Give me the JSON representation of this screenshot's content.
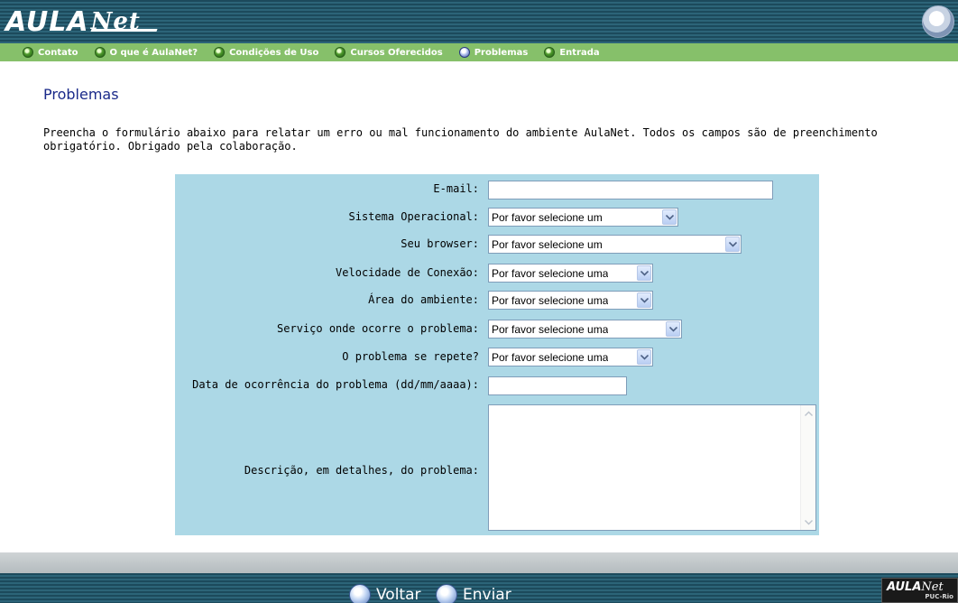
{
  "header": {
    "logo_main": "AULA",
    "logo_net": "Net",
    "nav": [
      {
        "label": "Contato"
      },
      {
        "label": "O que é AulaNet?"
      },
      {
        "label": "Condições de Uso"
      },
      {
        "label": "Cursos Oferecidos"
      },
      {
        "label": "Problemas"
      },
      {
        "label": "Entrada"
      }
    ],
    "active_nav": "Problemas"
  },
  "page": {
    "title": "Problemas",
    "intro": "Preencha o formulário abaixo para relatar um erro ou mal funcionamento do ambiente AulaNet. Todos os campos são de preenchimento obrigatório. Obrigado pela colaboração."
  },
  "form": {
    "email": {
      "label": "E-mail:",
      "value": ""
    },
    "os": {
      "label": "Sistema Operacional:",
      "selected": "Por favor selecione um"
    },
    "browser": {
      "label": "Seu browser:",
      "selected": "Por favor selecione um"
    },
    "connection": {
      "label": "Velocidade de Conexão:",
      "selected": "Por favor selecione uma"
    },
    "area": {
      "label": "Área do ambiente:",
      "selected": "Por favor selecione uma"
    },
    "service": {
      "label": "Serviço onde ocorre o problema:",
      "selected": "Por favor selecione uma"
    },
    "repeats": {
      "label": "O problema se repete?",
      "selected": "Por favor selecione uma"
    },
    "date": {
      "label": "Data de ocorrência do problema (dd/mm/aaaa):",
      "value": ""
    },
    "description": {
      "label": "Descrição, em detalhes, do problema:",
      "value": ""
    }
  },
  "footer": {
    "back_label": "Voltar",
    "send_label": "Enviar",
    "mini_logo_main": "AULA",
    "mini_logo_net": "Net",
    "mini_logo_sub": "PUC-Rio"
  },
  "colors": {
    "header_dark": "#1c4a5c",
    "nav_green": "#86c06a",
    "form_bg": "#acd8e6",
    "title_blue": "#1a2a8a"
  }
}
